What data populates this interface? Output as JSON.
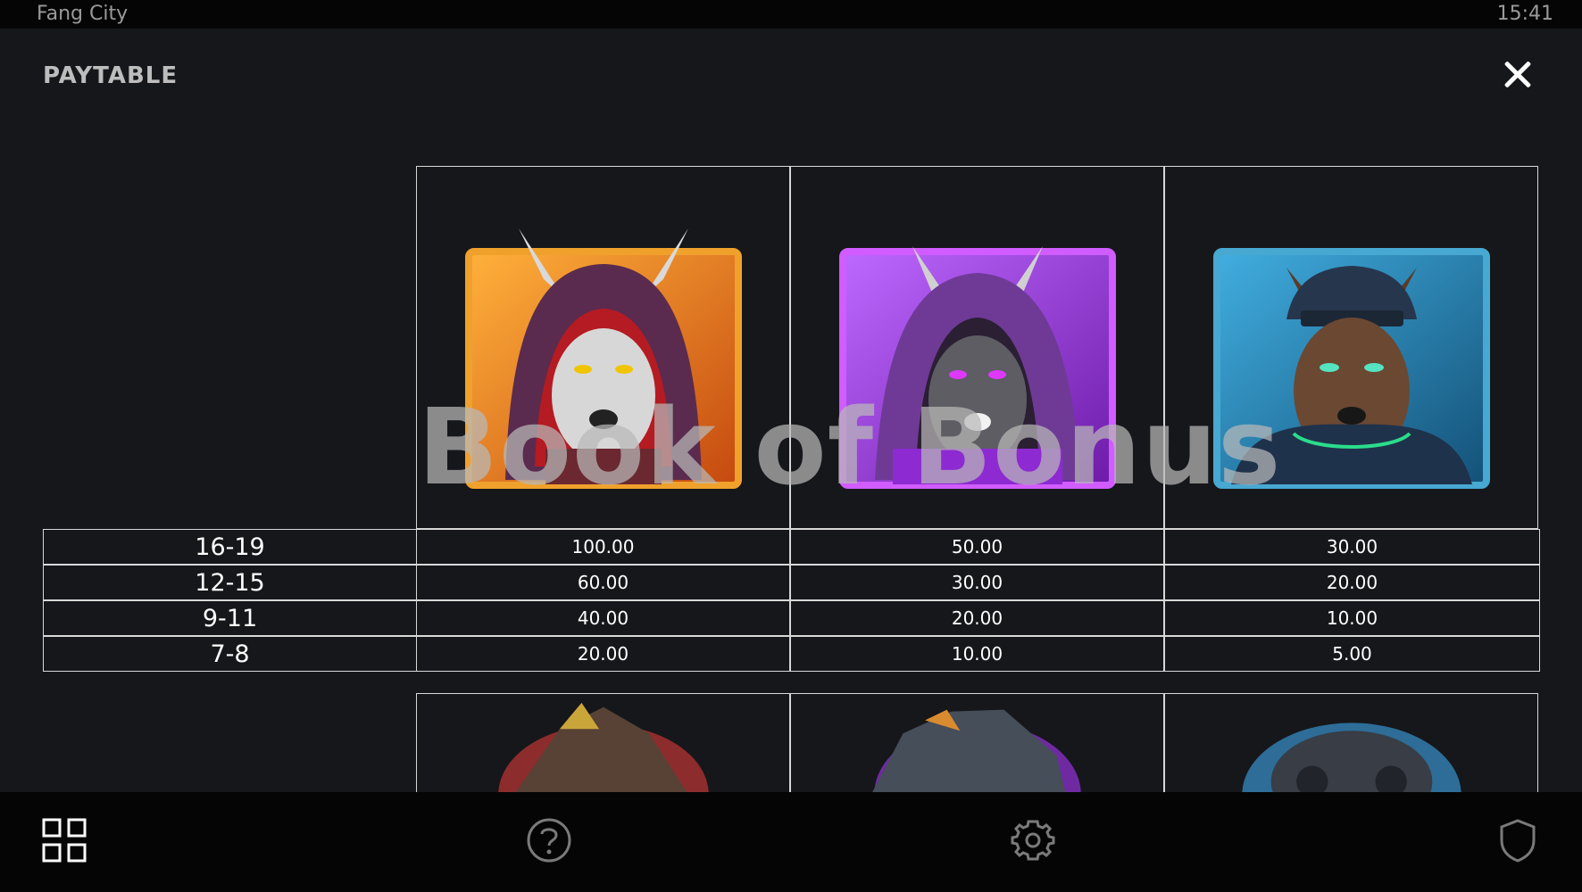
{
  "status_bar": {
    "app_name": "Fang City",
    "time": "15:41"
  },
  "header": {
    "title": "PAYTABLE",
    "close_icon": "close-icon"
  },
  "watermark": "Book of Bonus",
  "symbols": [
    {
      "name": "orange-hooded-wolf",
      "frame_color": "#e7801e"
    },
    {
      "name": "purple-hooded-wolf",
      "frame_color": "#9f45d8"
    },
    {
      "name": "blue-cap-wolf",
      "frame_color": "#2f86b8"
    }
  ],
  "paytable": {
    "rows": [
      {
        "range": "16-19",
        "values": [
          "100.00",
          "50.00",
          "30.00"
        ]
      },
      {
        "range": "12-15",
        "values": [
          "60.00",
          "30.00",
          "20.00"
        ]
      },
      {
        "range": "9-11",
        "values": [
          "40.00",
          "20.00",
          "10.00"
        ]
      },
      {
        "range": "7-8",
        "values": [
          "20.00",
          "10.00",
          "5.00"
        ]
      }
    ]
  },
  "bottom_nav": {
    "items": [
      {
        "name": "paytable-grid",
        "icon": "grid-icon"
      },
      {
        "name": "help",
        "icon": "question-icon"
      },
      {
        "name": "settings",
        "icon": "gear-icon"
      },
      {
        "name": "security",
        "icon": "shield-icon"
      }
    ]
  }
}
